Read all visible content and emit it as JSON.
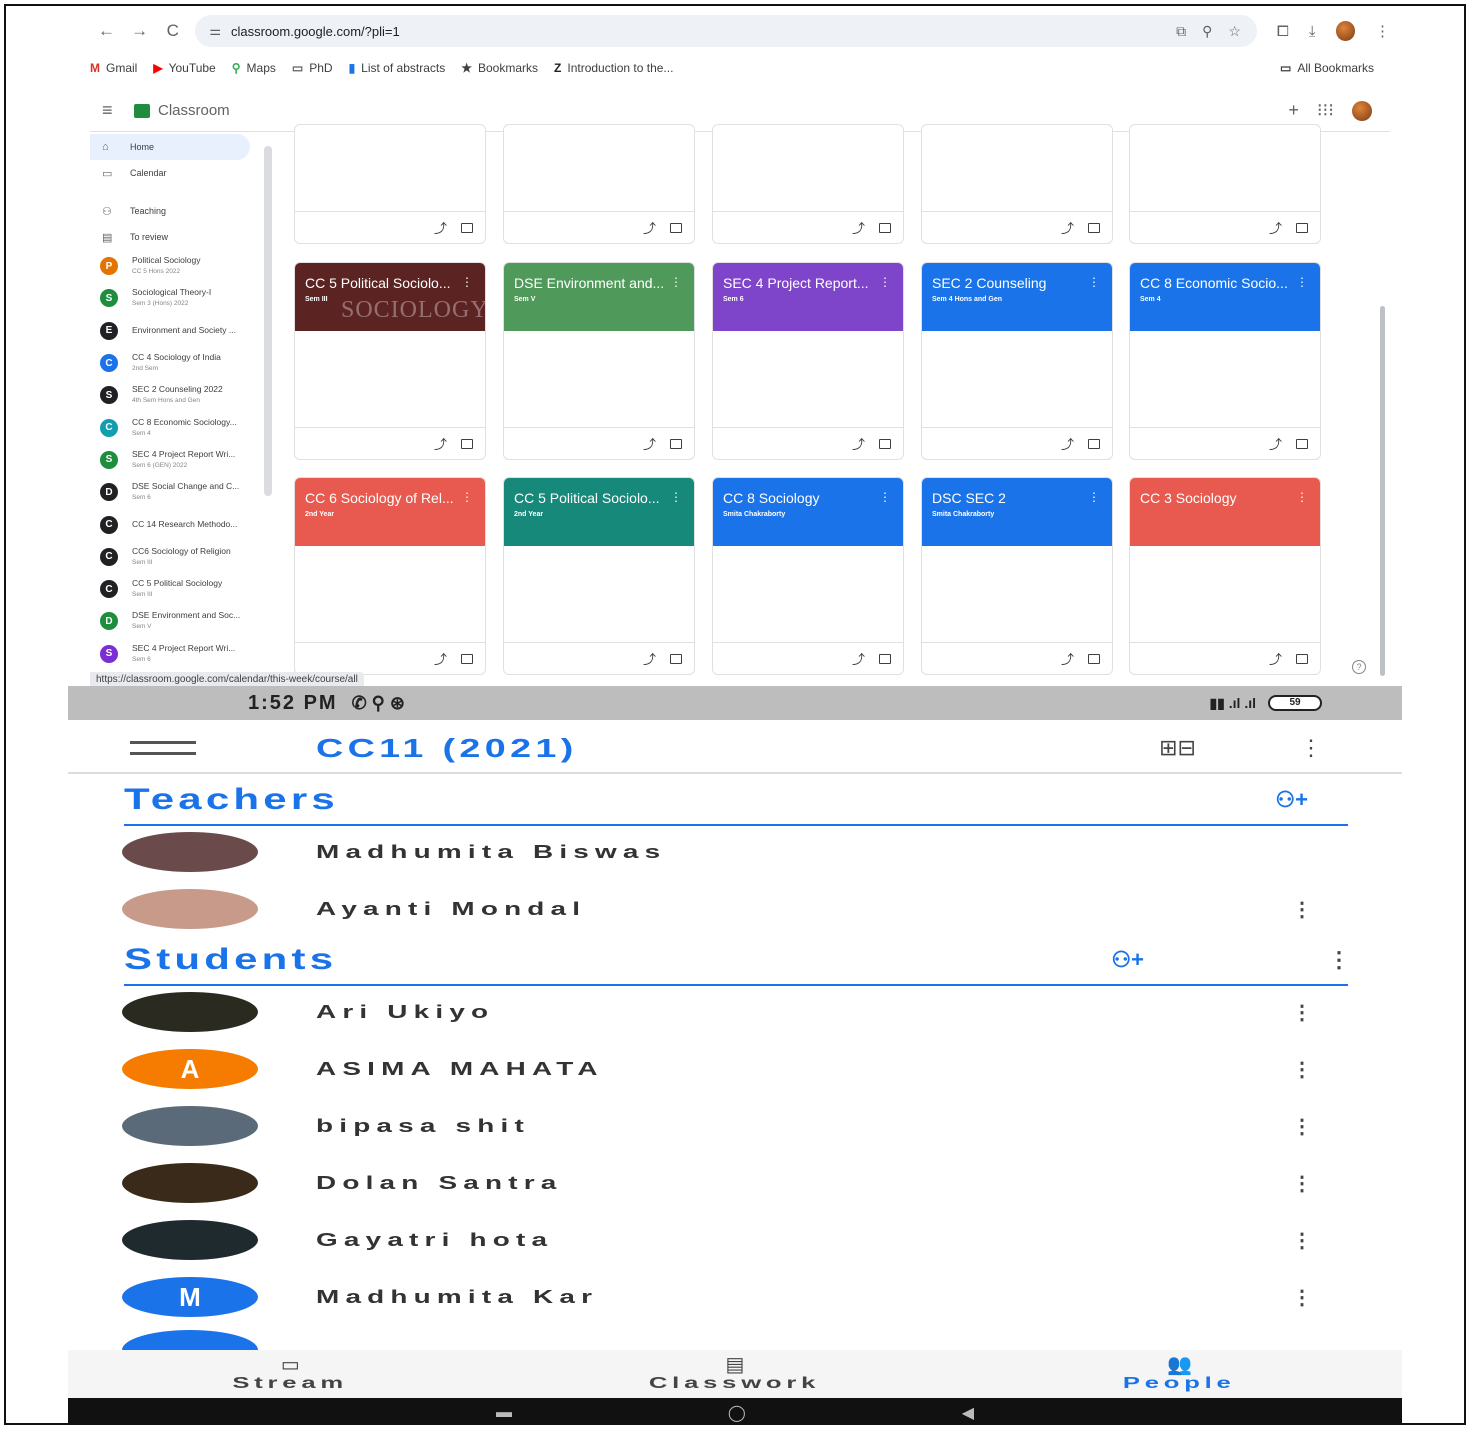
{
  "browser": {
    "url": "classroom.google.com/?pli=1",
    "bookmarks": [
      {
        "label": "Gmail",
        "icon": "M",
        "color": "#d93025"
      },
      {
        "label": "YouTube",
        "icon": "▶",
        "color": "#ff0000"
      },
      {
        "label": "Maps",
        "icon": "⚲",
        "color": "#34a853"
      },
      {
        "label": "PhD",
        "icon": "▭",
        "color": "#5f6368"
      },
      {
        "label": "List of abstracts",
        "icon": "▮",
        "color": "#1a73e8"
      },
      {
        "label": "Bookmarks",
        "icon": "★",
        "color": "#3c4043"
      },
      {
        "label": "Introduction to the...",
        "icon": "Z",
        "color": "#202124"
      }
    ],
    "all_bookmarks": "All Bookmarks",
    "status_url": "https://classroom.google.com/calendar/this-week/course/all"
  },
  "classroom": {
    "title": "Classroom",
    "nav": [
      {
        "label": "Home",
        "icon": "⌂"
      },
      {
        "label": "Calendar",
        "icon": "▭"
      }
    ],
    "teaching": "Teaching",
    "to_review": "To review",
    "classes": [
      {
        "letter": "P",
        "name": "Political Sociology",
        "sub": "CC 5 Hons 2022",
        "color": "#e37400"
      },
      {
        "letter": "S",
        "name": "Sociological Theory-I",
        "sub": "Sem 3 (Hons) 2022",
        "color": "#1e8e3e"
      },
      {
        "letter": "E",
        "name": "Environment and Society ...",
        "sub": "",
        "color": "#202124"
      },
      {
        "letter": "C",
        "name": "CC 4 Sociology of India",
        "sub": "2nd Sem",
        "color": "#1a73e8"
      },
      {
        "letter": "S",
        "name": "SEC 2 Counseling 2022",
        "sub": "4th Sem Hons and Gen",
        "color": "#202124"
      },
      {
        "letter": "C",
        "name": "CC 8 Economic Sociology...",
        "sub": "Sem 4",
        "color": "#129eaf"
      },
      {
        "letter": "S",
        "name": "SEC 4 Project Report Wri...",
        "sub": "Sem 6 (GEN) 2022",
        "color": "#1e8e3e"
      },
      {
        "letter": "D",
        "name": "DSE Social Change and C...",
        "sub": "Sem 6",
        "color": "#202124"
      },
      {
        "letter": "C",
        "name": "CC 14 Research Methodo...",
        "sub": "",
        "color": "#202124"
      },
      {
        "letter": "C",
        "name": "CC6 Sociology of Religion",
        "sub": "Sem III",
        "color": "#202124"
      },
      {
        "letter": "C",
        "name": "CC 5 Political Sociology",
        "sub": "Sem III",
        "color": "#202124"
      },
      {
        "letter": "D",
        "name": "DSE Environment and Soc...",
        "sub": "Sem V",
        "color": "#1e8e3e"
      },
      {
        "letter": "S",
        "name": "SEC 4 Project Report Wri...",
        "sub": "Sem 6",
        "color": "#7b2ed6"
      }
    ],
    "cards_row2": [
      {
        "title": "CC 5 Political Sociolo...",
        "sub": "Sem III",
        "color": "#5c2323",
        "bg_text": "SOCIOLOGY"
      },
      {
        "title": "DSE Environment and...",
        "sub": "Sem V",
        "color": "#4f9a5a",
        "bg_text": ""
      },
      {
        "title": "SEC 4 Project Report...",
        "sub": "Sem 6",
        "color": "#7e44c9",
        "bg_text": ""
      },
      {
        "title": "SEC 2 Counseling",
        "sub": "Sem 4 Hons and Gen",
        "color": "#1a73e8",
        "bg_text": ""
      },
      {
        "title": "CC 8 Economic Socio...",
        "sub": "Sem 4",
        "color": "#1a73e8",
        "bg_text": ""
      }
    ],
    "cards_row3": [
      {
        "title": "CC 6 Sociology of Rel...",
        "sub": "2nd Year",
        "color": "#e8594f"
      },
      {
        "title": "CC 5 Political Sociolo...",
        "sub": "2nd Year",
        "color": "#16897a"
      },
      {
        "title": "CC 8 Sociology",
        "sub": "Smita Chakraborty",
        "color": "#1a73e8"
      },
      {
        "title": "DSC SEC 2",
        "sub": "Smita Chakraborty",
        "color": "#1a73e8"
      },
      {
        "title": "CC 3 Sociology",
        "sub": "",
        "color": "#e8594f"
      }
    ]
  },
  "phone": {
    "time": "1:52 PM",
    "battery": "59",
    "course_title": "CC11 (2021)",
    "teachers_label": "Teachers",
    "students_label": "Students",
    "teachers": [
      {
        "name": "Madhumita Biswas",
        "avatar": "photo",
        "color": "#6a4a4a"
      },
      {
        "name": "Ayanti Mondal",
        "avatar": "photo",
        "color": "#c89a8a"
      }
    ],
    "students": [
      {
        "name": "Ari Ukiyo",
        "letter": "",
        "color": "#2a2a20"
      },
      {
        "name": "ASIMA MAHATA",
        "letter": "A",
        "color": "#f57c00"
      },
      {
        "name": "bipasa shit",
        "letter": "",
        "color": "#5a6a78"
      },
      {
        "name": "Dolan Santra",
        "letter": "",
        "color": "#3a2a1a"
      },
      {
        "name": "Gayatri hota",
        "letter": "",
        "color": "#1e2a2e"
      },
      {
        "name": "Madhumita Kar",
        "letter": "M",
        "color": "#1a73e8"
      }
    ],
    "tabs": [
      {
        "label": "Stream",
        "icon": "▭"
      },
      {
        "label": "Classwork",
        "icon": "▤"
      },
      {
        "label": "People",
        "icon": "👥"
      }
    ]
  }
}
